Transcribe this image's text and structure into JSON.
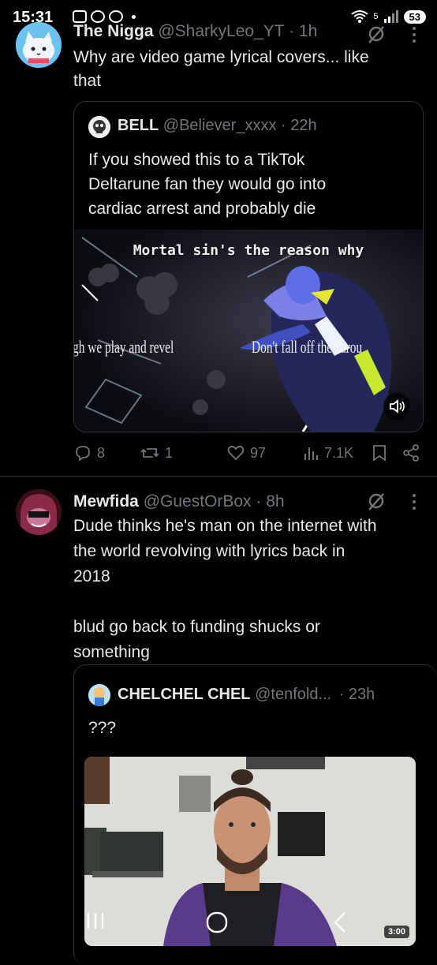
{
  "status_bar": {
    "time": "15:31",
    "battery": "53",
    "wifi_badge": "5"
  },
  "posts": [
    {
      "display_name": "The Nigga",
      "handle": "@SharkyLeo_YT",
      "time": "· 1h",
      "text_lines": [
        "Why are video game lyrical covers... like",
        "that"
      ],
      "quote": {
        "display_name": "BELL",
        "handle": "@Believer_xxxx",
        "time": "· 22h",
        "text_lines": [
          "If you showed this to a TikTok",
          "Deltarune fan they would go into",
          "cardiac arrest and probably die"
        ],
        "video_captions": {
          "top": "Mortal sin's the reason why",
          "left": "gh we play and revel",
          "right": "Don't fall off the carou"
        }
      },
      "actions": {
        "replies": "8",
        "reposts": "1",
        "likes": "97",
        "views": "7.1K"
      }
    },
    {
      "display_name": "Mewfida",
      "handle": "@GuestOrBox",
      "time": "· 8h",
      "text_lines": [
        "Dude thinks he's man on the internet with",
        "the world revolving with lyrics back in",
        "2018",
        "",
        "blud go back to funding shucks or",
        "something"
      ],
      "quote": {
        "display_name": "CHELCHEL CHEL",
        "handle": "@tenfold...",
        "time": "· 23h",
        "text_lines": [
          "???"
        ],
        "video_duration": "3:00"
      }
    }
  ],
  "icons": [
    "grok-icon",
    "more-icon",
    "reply-icon",
    "repost-icon",
    "like-icon",
    "views-icon",
    "bookmark-icon",
    "share-icon",
    "volume-icon"
  ],
  "colors": {
    "background": "#000000",
    "text": "#e7e9ea",
    "muted": "#71767b",
    "border": "#2f3336"
  }
}
